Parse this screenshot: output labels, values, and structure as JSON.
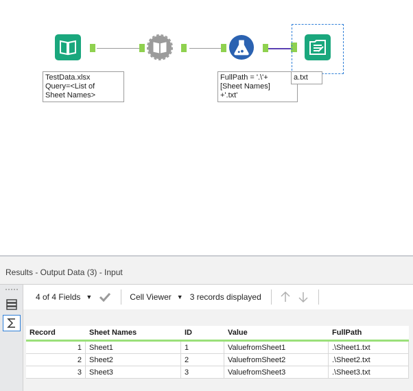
{
  "workflow": {
    "tools": [
      {
        "name": "input-data-tool",
        "icon": "book-icon",
        "color": "#1aa77d"
      },
      {
        "name": "dynamic-input-tool",
        "icon": "gear-book-icon",
        "color": "#9b9b9b"
      },
      {
        "name": "formula-tool",
        "icon": "flask-icon",
        "color": "#2b62b1"
      },
      {
        "name": "output-data-tool",
        "icon": "output-doc-icon",
        "color": "#1aa77d"
      }
    ],
    "annotations": {
      "input": "TestData.xlsx\nQuery=<List of\nSheet Names>",
      "formula": "FullPath = '.\\'+\n[Sheet Names]\n+'.txt'",
      "output": "a.txt"
    }
  },
  "results": {
    "title": "Results - Output Data (3) - Input",
    "toolbar": {
      "fields": "4 of 4 Fields",
      "cell_viewer": "Cell Viewer",
      "records": "3 records displayed"
    },
    "columns": [
      "Record",
      "Sheet Names",
      "ID",
      "Value",
      "FullPath"
    ],
    "rows": [
      [
        "1",
        "Sheet1",
        "1",
        "ValuefromSheet1",
        ".\\Sheet1.txt"
      ],
      [
        "2",
        "Sheet2",
        "2",
        "ValuefromSheet2",
        ".\\Sheet2.txt"
      ],
      [
        "3",
        "Sheet3",
        "3",
        "ValuefromSheet3",
        ".\\Sheet3.txt"
      ]
    ]
  }
}
